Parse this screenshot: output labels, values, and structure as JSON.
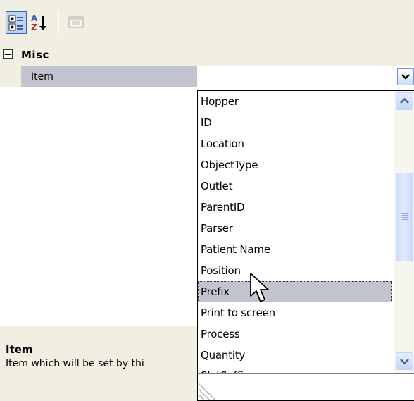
{
  "toolbar": {
    "buttons": [
      {
        "id": "categorized",
        "icon": "categorized-icon",
        "state": "pressed"
      },
      {
        "id": "alphabetical",
        "icon": "sort-az-icon"
      },
      {
        "id": "property-pages",
        "icon": "property-pages-icon",
        "state": "disabled"
      }
    ]
  },
  "grid": {
    "category": {
      "expander": "⊟",
      "label": "Misc"
    },
    "item": {
      "name": "Item",
      "value": ""
    }
  },
  "dropdown": {
    "items": [
      "Hopper",
      "ID",
      "Location",
      "ObjectType",
      "Outlet",
      "ParentID",
      "Parser",
      "Patient Name",
      "Position",
      "Prefix",
      "Print to screen",
      "Process",
      "Quantity",
      "SlotSuffix"
    ],
    "selected": "Prefix"
  },
  "help": {
    "title": "Item",
    "description": "Item which will be set by thi"
  },
  "colors": {
    "chrome": "#f1efe2",
    "selection": "#c2c4cf",
    "accent": "#316ac5",
    "scroll": "#c5d6fb"
  }
}
